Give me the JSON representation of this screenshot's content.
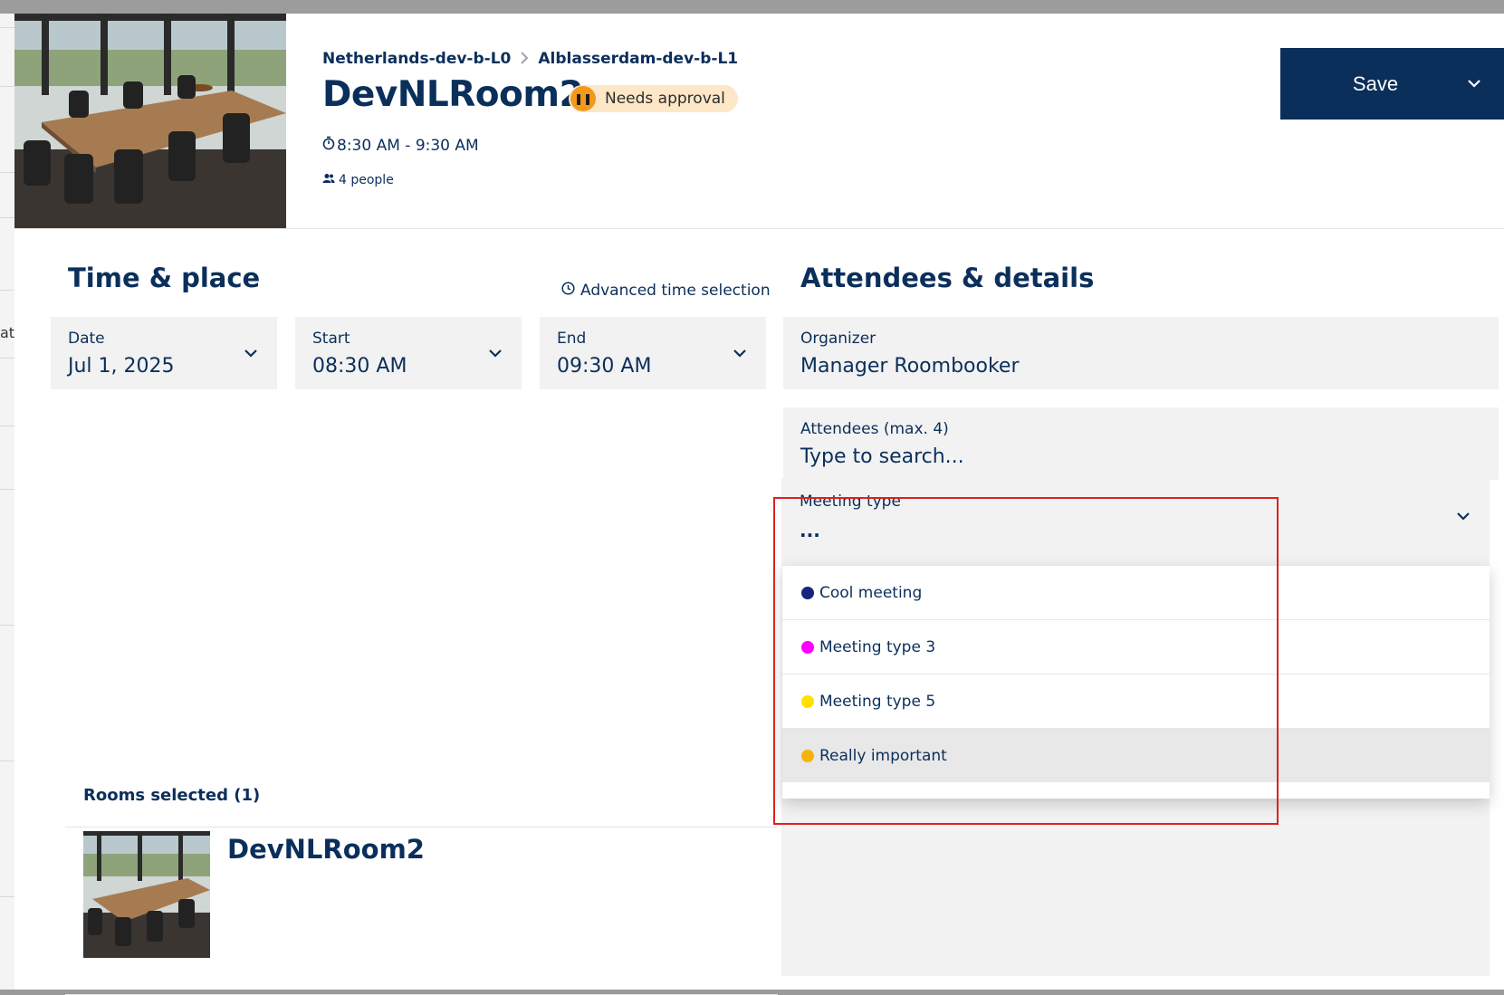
{
  "background": {
    "fragment": "atf"
  },
  "header": {
    "breadcrumb": [
      "Netherlands-dev-b-L0",
      "Alblasserdam-dev-b-L1"
    ],
    "title": "DevNLRoom2",
    "status": "Needs approval",
    "time_range": "8:30 AM - 9:30 AM",
    "people": "4 people",
    "save_label": "Save"
  },
  "time_place": {
    "title": "Time & place",
    "advanced_link": "Advanced time selection",
    "date": {
      "label": "Date",
      "value": "Jul 1, 2025"
    },
    "start": {
      "label": "Start",
      "value": "08:30 AM"
    },
    "end": {
      "label": "End",
      "value": "09:30 AM"
    }
  },
  "rooms": {
    "heading": "Rooms selected (1)",
    "items": [
      {
        "name": "DevNLRoom2"
      }
    ]
  },
  "attendees_details": {
    "title": "Attendees & details",
    "organizer": {
      "label": "Organizer",
      "value": "Manager Roombooker"
    },
    "attendees": {
      "label": "Attendees (max. 4)",
      "placeholder": "Type to search..."
    },
    "meeting_type": {
      "label": "Meeting type",
      "value": "...",
      "options": [
        {
          "label": "Cool meeting",
          "color": "#1a237e"
        },
        {
          "label": "Meeting type 3",
          "color": "#ff00ff"
        },
        {
          "label": "Meeting type 5",
          "color": "#ffe000"
        },
        {
          "label": "Really important",
          "color": "#f5b40a"
        }
      ]
    }
  },
  "colors": {
    "primary": "#0b2f5b",
    "badge_bg": "#fde7c7",
    "badge_icon": "#f39a1d",
    "highlight": "#e02020"
  }
}
